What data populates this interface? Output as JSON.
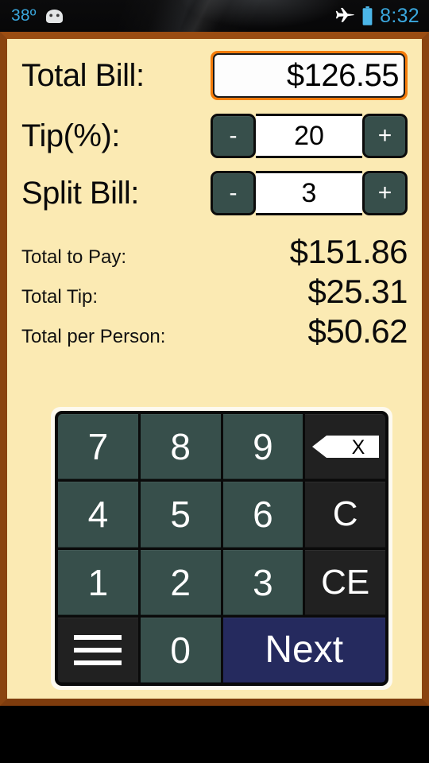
{
  "statusbar": {
    "temperature": "38º",
    "time": "8:32",
    "icons": {
      "droid": "android-droid-icon",
      "airplane": "airplane-mode-icon",
      "battery": "battery-icon"
    },
    "accent_text_color": "#3aa7dd"
  },
  "app": {
    "frame_color": "#8a4410",
    "background_color": "#fbeab3",
    "rows": [
      {
        "label": "Total Bill:",
        "value": "$126.55",
        "focused": true
      },
      {
        "label": "Tip(%):",
        "value": "20",
        "minus": "-",
        "plus": "+"
      },
      {
        "label": "Split Bill:",
        "value": "3",
        "minus": "-",
        "plus": "+"
      }
    ],
    "results": [
      {
        "label": "Total to Pay:",
        "value": "$151.86"
      },
      {
        "label": "Total Tip:",
        "value": "$25.31"
      },
      {
        "label": "Total per Person:",
        "value": "$50.62"
      }
    ],
    "keypad": {
      "keys": [
        {
          "label": "7",
          "name": "key-7",
          "style": "digit"
        },
        {
          "label": "8",
          "name": "key-8",
          "style": "digit"
        },
        {
          "label": "9",
          "name": "key-9",
          "style": "digit"
        },
        {
          "label": "",
          "name": "key-backspace",
          "style": "dark",
          "icon": "backspace-icon"
        },
        {
          "label": "4",
          "name": "key-4",
          "style": "digit"
        },
        {
          "label": "5",
          "name": "key-5",
          "style": "digit"
        },
        {
          "label": "6",
          "name": "key-6",
          "style": "digit"
        },
        {
          "label": "C",
          "name": "key-clear",
          "style": "dark"
        },
        {
          "label": "1",
          "name": "key-1",
          "style": "digit"
        },
        {
          "label": "2",
          "name": "key-2",
          "style": "digit"
        },
        {
          "label": "3",
          "name": "key-3",
          "style": "digit"
        },
        {
          "label": "CE",
          "name": "key-clear-entry",
          "style": "dark"
        },
        {
          "label": "",
          "name": "key-menu",
          "style": "dark",
          "icon": "menu-icon"
        },
        {
          "label": "0",
          "name": "key-0",
          "style": "digit"
        },
        {
          "label": "Next",
          "name": "key-next",
          "style": "next"
        }
      ],
      "colors": {
        "digit_key": "#374f4b",
        "dark_key": "#212121",
        "next_key": "#252a5e",
        "key_text": "#ffffff"
      }
    }
  }
}
